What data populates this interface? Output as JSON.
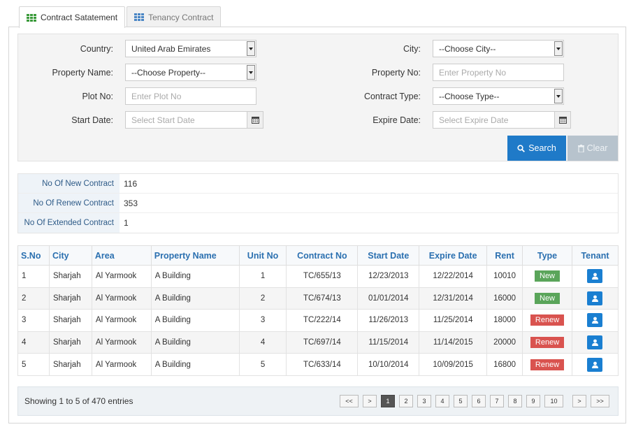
{
  "tabs": [
    {
      "label": "Contract Satatement",
      "active": true
    },
    {
      "label": "Tenancy Contract",
      "active": false
    }
  ],
  "filters": {
    "country": {
      "label": "Country:",
      "value": "United Arab Emirates"
    },
    "city": {
      "label": "City:",
      "value": "--Choose City--"
    },
    "property_name": {
      "label": "Property Name:",
      "value": "--Choose Property--"
    },
    "property_no": {
      "label": "Property No:",
      "placeholder": "Enter Property No"
    },
    "plot_no": {
      "label": "Plot No:",
      "placeholder": "Enter Plot No"
    },
    "contract_type": {
      "label": "Contract Type:",
      "value": "--Choose Type--"
    },
    "start_date": {
      "label": "Start Date:",
      "placeholder": "Select Start Date"
    },
    "expire_date": {
      "label": "Expire Date:",
      "placeholder": "Select Expire Date"
    },
    "search_label": "Search",
    "clear_label": "Clear"
  },
  "summary": [
    {
      "label": "No Of New Contract",
      "value": "116"
    },
    {
      "label": "No Of Renew Contract",
      "value": "353"
    },
    {
      "label": "No Of Extended Contract",
      "value": "1"
    }
  ],
  "table": {
    "headers": [
      "S.No",
      "City",
      "Area",
      "Property Name",
      "Unit No",
      "Contract No",
      "Start Date",
      "Expire Date",
      "Rent",
      "Type",
      "Tenant"
    ],
    "rows": [
      {
        "sno": "1",
        "city": "Sharjah",
        "area": "Al Yarmook",
        "property": "A Building",
        "unit": "1",
        "contract": "TC/655/13",
        "start": "12/23/2013",
        "expire": "12/22/2014",
        "rent": "10010",
        "type": "New"
      },
      {
        "sno": "2",
        "city": "Sharjah",
        "area": "Al Yarmook",
        "property": "A Building",
        "unit": "2",
        "contract": "TC/674/13",
        "start": "01/01/2014",
        "expire": "12/31/2014",
        "rent": "16000",
        "type": "New"
      },
      {
        "sno": "3",
        "city": "Sharjah",
        "area": "Al Yarmook",
        "property": "A Building",
        "unit": "3",
        "contract": "TC/222/14",
        "start": "11/26/2013",
        "expire": "11/25/2014",
        "rent": "18000",
        "type": "Renew"
      },
      {
        "sno": "4",
        "city": "Sharjah",
        "area": "Al Yarmook",
        "property": "A Building",
        "unit": "4",
        "contract": "TC/697/14",
        "start": "11/15/2014",
        "expire": "11/14/2015",
        "rent": "20000",
        "type": "Renew"
      },
      {
        "sno": "5",
        "city": "Sharjah",
        "area": "Al Yarmook",
        "property": "A Building",
        "unit": "5",
        "contract": "TC/633/14",
        "start": "10/10/2014",
        "expire": "10/09/2015",
        "rent": "16800",
        "type": "Renew"
      }
    ]
  },
  "footer": {
    "info": "Showing 1 to 5 of 470 entries",
    "pages": [
      "<<",
      ">",
      "1",
      "2",
      "3",
      "4",
      "5",
      "6",
      "7",
      "8",
      "9",
      "10",
      ">",
      ">>"
    ],
    "active_page": "1"
  },
  "colors": {
    "accent": "#1f7ac8",
    "new_badge": "#5aa55a",
    "renew_badge": "#d9534f",
    "header_text": "#2b70b0"
  }
}
